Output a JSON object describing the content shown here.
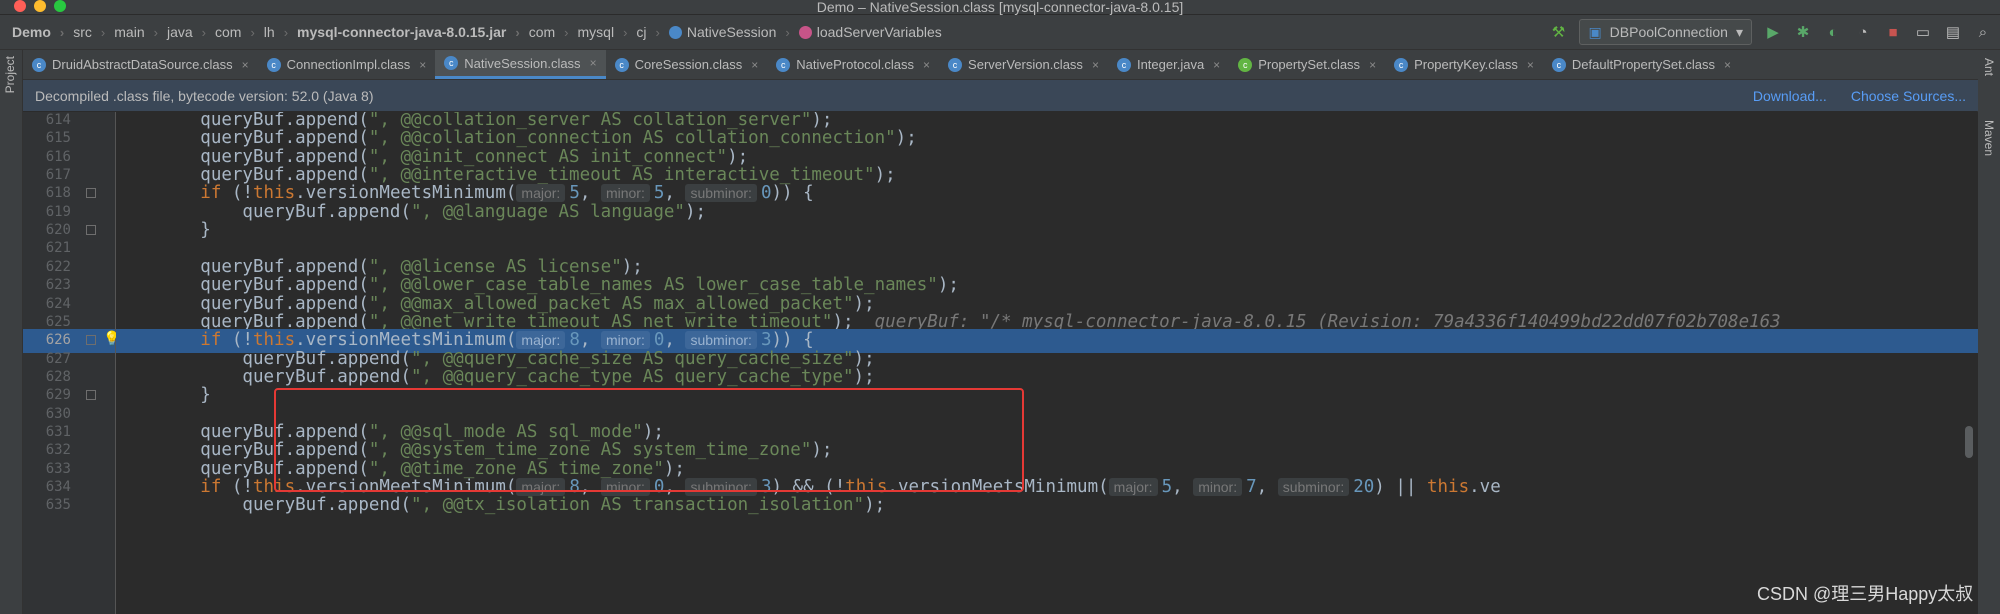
{
  "window": {
    "title": "Demo – NativeSession.class [mysql-connector-java-8.0.15]"
  },
  "breadcrumbs": [
    {
      "label": "Demo",
      "bold": true,
      "icon": ""
    },
    {
      "label": "src",
      "bold": false,
      "icon": ""
    },
    {
      "label": "main",
      "bold": false,
      "icon": ""
    },
    {
      "label": "java",
      "bold": false,
      "icon": ""
    },
    {
      "label": "com",
      "bold": false,
      "icon": ""
    },
    {
      "label": "lh",
      "bold": false,
      "icon": ""
    },
    {
      "label": "mysql-connector-java-8.0.15.jar",
      "bold": true,
      "icon": ""
    },
    {
      "label": "com",
      "bold": false,
      "icon": ""
    },
    {
      "label": "mysql",
      "bold": false,
      "icon": ""
    },
    {
      "label": "cj",
      "bold": false,
      "icon": ""
    },
    {
      "label": "NativeSession",
      "bold": false,
      "icon": "class-icon"
    },
    {
      "label": "loadServerVariables",
      "bold": false,
      "icon": "method-icon"
    }
  ],
  "run_config": {
    "label": "DBPoolConnection"
  },
  "side_tools": {
    "left": "Project",
    "right_ant": "Ant",
    "right_maven": "Maven"
  },
  "tabs": [
    {
      "label": "DruidAbstractDataSource.class",
      "active": false,
      "color": "#4a88c7"
    },
    {
      "label": "ConnectionImpl.class",
      "active": false,
      "color": "#4a88c7"
    },
    {
      "label": "NativeSession.class",
      "active": true,
      "color": "#4a88c7"
    },
    {
      "label": "CoreSession.class",
      "active": false,
      "color": "#4a88c7"
    },
    {
      "label": "NativeProtocol.class",
      "active": false,
      "color": "#4a88c7"
    },
    {
      "label": "ServerVersion.class",
      "active": false,
      "color": "#4a88c7"
    },
    {
      "label": "Integer.java",
      "active": false,
      "color": "#4a88c7"
    },
    {
      "label": "PropertySet.class",
      "active": false,
      "color": "#62b543"
    },
    {
      "label": "PropertyKey.class",
      "active": false,
      "color": "#4a88c7"
    },
    {
      "label": "DefaultPropertySet.class",
      "active": false,
      "color": "#4a88c7"
    }
  ],
  "banner": {
    "message": "Decompiled .class file, bytecode version: 52.0 (Java 8)",
    "download": "Download...",
    "choose_sources": "Choose Sources..."
  },
  "code_lines": [
    {
      "n": "614",
      "segs": [
        [
          "t",
          "        queryBuf.append("
        ],
        [
          "s",
          "\", @@collation_server AS collation_server\""
        ],
        [
          "t",
          ");"
        ]
      ]
    },
    {
      "n": "615",
      "segs": [
        [
          "t",
          "        queryBuf.append("
        ],
        [
          "s",
          "\", @@collation_connection AS collation_connection\""
        ],
        [
          "t",
          ");"
        ]
      ]
    },
    {
      "n": "616",
      "segs": [
        [
          "t",
          "        queryBuf.append("
        ],
        [
          "s",
          "\", @@init_connect AS init_connect\""
        ],
        [
          "t",
          ");"
        ]
      ]
    },
    {
      "n": "617",
      "segs": [
        [
          "t",
          "        queryBuf.append("
        ],
        [
          "s",
          "\", @@interactive_timeout AS interactive_timeout\""
        ],
        [
          "t",
          ");"
        ]
      ]
    },
    {
      "n": "618",
      "fold": true,
      "segs": [
        [
          "t",
          "        "
        ],
        [
          "k",
          "if"
        ],
        [
          "t",
          " (!"
        ],
        [
          "k",
          "this"
        ],
        [
          "t",
          ".versionMeetsMinimum("
        ],
        [
          "h",
          "major:"
        ],
        [
          "n",
          "5"
        ],
        [
          "t",
          ", "
        ],
        [
          "h",
          "minor:"
        ],
        [
          "n",
          "5"
        ],
        [
          "t",
          ", "
        ],
        [
          "h",
          "subminor:"
        ],
        [
          "n",
          "0"
        ],
        [
          "t",
          ")) {"
        ]
      ]
    },
    {
      "n": "619",
      "segs": [
        [
          "t",
          "            queryBuf.append("
        ],
        [
          "s",
          "\", @@language AS language\""
        ],
        [
          "t",
          ");"
        ]
      ]
    },
    {
      "n": "620",
      "fold": true,
      "segs": [
        [
          "t",
          "        }"
        ]
      ]
    },
    {
      "n": "621",
      "segs": []
    },
    {
      "n": "622",
      "segs": [
        [
          "t",
          "        queryBuf.append("
        ],
        [
          "s",
          "\", @@license AS license\""
        ],
        [
          "t",
          ");"
        ]
      ]
    },
    {
      "n": "623",
      "segs": [
        [
          "t",
          "        queryBuf.append("
        ],
        [
          "s",
          "\", @@lower_case_table_names AS lower_case_table_names\""
        ],
        [
          "t",
          ");"
        ]
      ]
    },
    {
      "n": "624",
      "segs": [
        [
          "t",
          "        queryBuf.append("
        ],
        [
          "s",
          "\", @@max_allowed_packet AS max_allowed_packet\""
        ],
        [
          "t",
          ");"
        ]
      ]
    },
    {
      "n": "625",
      "segs": [
        [
          "t",
          "        queryBuf.append("
        ],
        [
          "s",
          "\", @@net_write_timeout AS net_write_timeout\""
        ],
        [
          "t",
          ");  "
        ],
        [
          "i",
          "queryBuf: "
        ],
        [
          "v",
          "\"/* mysql-connector-java-8.0.15 (Revision: 79a4336f140499bd22dd07f02b708e163"
        ]
      ]
    },
    {
      "n": "626",
      "hl": true,
      "fold": true,
      "bulb": true,
      "segs": [
        [
          "t",
          "        "
        ],
        [
          "k",
          "if"
        ],
        [
          "t",
          " (!"
        ],
        [
          "k",
          "this"
        ],
        [
          "t",
          ".versionMeetsMinimum("
        ],
        [
          "h",
          "major:"
        ],
        [
          "n",
          "8"
        ],
        [
          "t",
          ", "
        ],
        [
          "h",
          "minor:"
        ],
        [
          "n",
          "0"
        ],
        [
          "t",
          ", "
        ],
        [
          "h",
          "subminor:"
        ],
        [
          "n",
          "3"
        ],
        [
          "t",
          ")) {"
        ]
      ]
    },
    {
      "n": "627",
      "segs": [
        [
          "t",
          "            queryBuf.append("
        ],
        [
          "s",
          "\", @@query_cache_size AS query_cache_size\""
        ],
        [
          "t",
          ");"
        ]
      ]
    },
    {
      "n": "628",
      "segs": [
        [
          "t",
          "            queryBuf.append("
        ],
        [
          "s",
          "\", @@query_cache_type AS query_cache_type\""
        ],
        [
          "t",
          ");"
        ]
      ]
    },
    {
      "n": "629",
      "fold": true,
      "segs": [
        [
          "t",
          "        }"
        ]
      ]
    },
    {
      "n": "630",
      "segs": []
    },
    {
      "n": "631",
      "segs": [
        [
          "t",
          "        queryBuf.append("
        ],
        [
          "s",
          "\", @@sql_mode AS sql_mode\""
        ],
        [
          "t",
          ");"
        ]
      ]
    },
    {
      "n": "632",
      "segs": [
        [
          "t",
          "        queryBuf.append("
        ],
        [
          "s",
          "\", @@system_time_zone AS system_time_zone\""
        ],
        [
          "t",
          ");"
        ]
      ]
    },
    {
      "n": "633",
      "segs": [
        [
          "t",
          "        queryBuf.append("
        ],
        [
          "s",
          "\", @@time_zone AS time_zone\""
        ],
        [
          "t",
          ");"
        ]
      ]
    },
    {
      "n": "634",
      "segs": [
        [
          "t",
          "        "
        ],
        [
          "k",
          "if"
        ],
        [
          "t",
          " (!"
        ],
        [
          "k",
          "this"
        ],
        [
          "t",
          ".versionMeetsMinimum("
        ],
        [
          "h",
          "major:"
        ],
        [
          "n",
          "8"
        ],
        [
          "t",
          ", "
        ],
        [
          "h",
          "minor:"
        ],
        [
          "n",
          "0"
        ],
        [
          "t",
          ", "
        ],
        [
          "h",
          "subminor:"
        ],
        [
          "n",
          "3"
        ],
        [
          "t",
          ") && (!"
        ],
        [
          "k",
          "this"
        ],
        [
          "t",
          ".versionMeetsMinimum("
        ],
        [
          "h",
          "major:"
        ],
        [
          "n",
          "5"
        ],
        [
          "t",
          ", "
        ],
        [
          "h",
          "minor:"
        ],
        [
          "n",
          "7"
        ],
        [
          "t",
          ", "
        ],
        [
          "h",
          "subminor:"
        ],
        [
          "n",
          "20"
        ],
        [
          "t",
          ") || "
        ],
        [
          "k",
          "this"
        ],
        [
          "t",
          ".ve"
        ]
      ]
    },
    {
      "n": "635",
      "segs": [
        [
          "t",
          "            queryBuf.append("
        ],
        [
          "s",
          "\", @@tx_isolation AS transaction_isolation\""
        ],
        [
          "t",
          ");"
        ]
      ]
    }
  ],
  "watermark": "CSDN @理三男Happy太叔",
  "colors": {
    "accent": "#4a88c7",
    "highlight": "#2d5a8f",
    "annotation_box": "#e53935"
  }
}
